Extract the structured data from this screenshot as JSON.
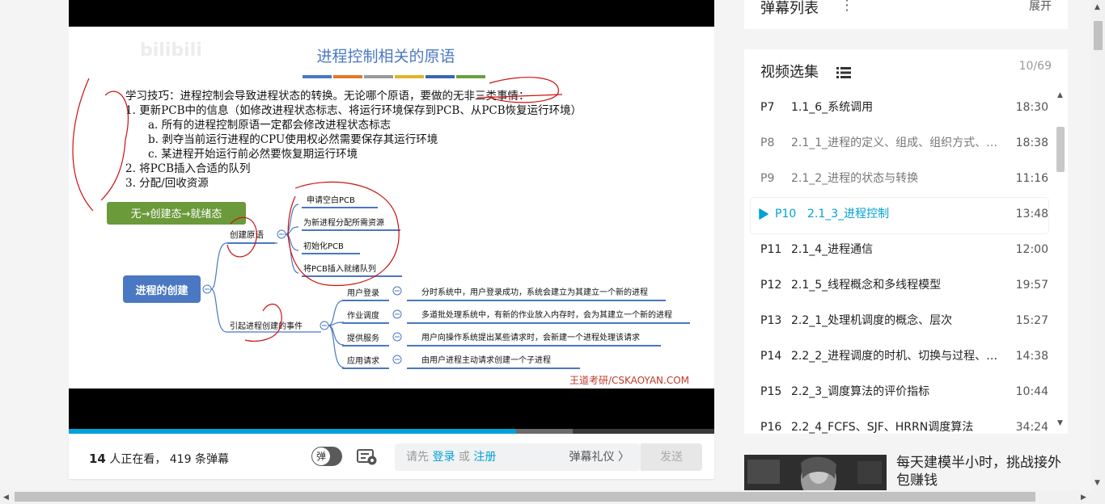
{
  "slide": {
    "watermark": "bilibili",
    "title": "进程控制相关的原语",
    "intro": "学习技巧：进程控制会导致进程状态的转换。无论哪个原语，要做的无非三类事情：",
    "steps": [
      "1.  更新PCB中的信息（如修改进程状态标志、将运行环境保存到PCB、从PCB恢复运行环境）",
      "a. 所有的进程控制原语一定都会修改进程状态标志",
      "b. 剥夺当前运行进程的CPU使用权必然需要保存其运行环境",
      "c. 某进程开始运行前必然要恢复期运行环境",
      "2.  将PCB插入合适的队列",
      "3.  分配/回收资源"
    ],
    "green_tag": "无→创建态→就绪态",
    "root": "进程的创建",
    "branch1": "创建原语",
    "branch1_items": [
      "申请空白PCB",
      "为新进程分配所需资源",
      "初始化PCB",
      "将PCB插入就绪队列"
    ],
    "branch2": "引起进程创建的事件",
    "events": [
      {
        "name": "用户登录",
        "desc": "分时系统中，用户登录成功，系统会建立为其建立一个新的进程"
      },
      {
        "name": "作业调度",
        "desc": "多道批处理系统中，有新的作业放入内存时，会为其建立一个新的进程"
      },
      {
        "name": "提供服务",
        "desc": "用户向操作系统提出某些请求时，会新建一个进程处理该请求"
      },
      {
        "name": "应用请求",
        "desc": "由用户进程主动请求创建一个子进程"
      }
    ],
    "source": "王道考研/CSKAOYAN.COM"
  },
  "player": {
    "progress": 0.7
  },
  "bottombar": {
    "viewers_count": "14",
    "viewers_text": " 人正在看， 419 条弹幕",
    "toggle_label": "弹",
    "input_prefix": "请先 ",
    "login": "登录",
    "or": " 或 ",
    "register": "注册",
    "etiquette": "弹幕礼仪 〉",
    "send": "发送"
  },
  "danmaku_panel": {
    "title": "弹幕列表",
    "more": "⋮",
    "expand": "展开"
  },
  "episodes": {
    "title": "视频选集",
    "count": "10/69",
    "items": [
      {
        "num": "P7",
        "name": "1.1_6_系统调用",
        "dur": "18:30"
      },
      {
        "num": "P8",
        "name": "2.1_1_进程的定义、组成、组织方式、特征",
        "dur": "18:38"
      },
      {
        "num": "P9",
        "name": "2.1_2_进程的状态与转换",
        "dur": "11:16"
      },
      {
        "num": "P10",
        "name": "2.1_3_进程控制",
        "dur": "13:48"
      },
      {
        "num": "P11",
        "name": "2.1_4_进程通信",
        "dur": "12:00"
      },
      {
        "num": "P12",
        "name": "2.1_5_线程概念和多线程模型",
        "dur": "19:57"
      },
      {
        "num": "P13",
        "name": "2.2_1_处理机调度的概念、层次",
        "dur": "15:27"
      },
      {
        "num": "P14",
        "name": "2.2_2_进程调度的时机、切换与过程、方式",
        "dur": "14:38"
      },
      {
        "num": "P15",
        "name": "2.2_3_调度算法的评价指标",
        "dur": "10:44"
      },
      {
        "num": "P16",
        "name": "2.2_4_FCFS、SJF、HRRN调度算法",
        "dur": "34:24"
      }
    ]
  },
  "recommend": {
    "title": "每天建模半小时，挑战接外包赚钱"
  },
  "colors": {
    "accent": "#00a1d6",
    "slide_blue": "#4a78c2",
    "green_tag": "#6a9a3a",
    "pen_red": "#cc1111"
  }
}
